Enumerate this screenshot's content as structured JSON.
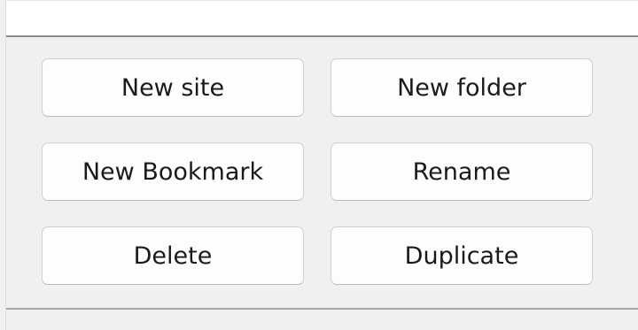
{
  "buttons": {
    "new_site": "New site",
    "new_folder": "New folder",
    "new_bookmark": "New Bookmark",
    "rename": "Rename",
    "delete": "Delete",
    "duplicate": "Duplicate"
  },
  "colors": {
    "panel_background": "#f0f0f0",
    "button_background": "#fdfdfd",
    "button_border": "#cfcfcf",
    "text": "#1a1a1a"
  }
}
